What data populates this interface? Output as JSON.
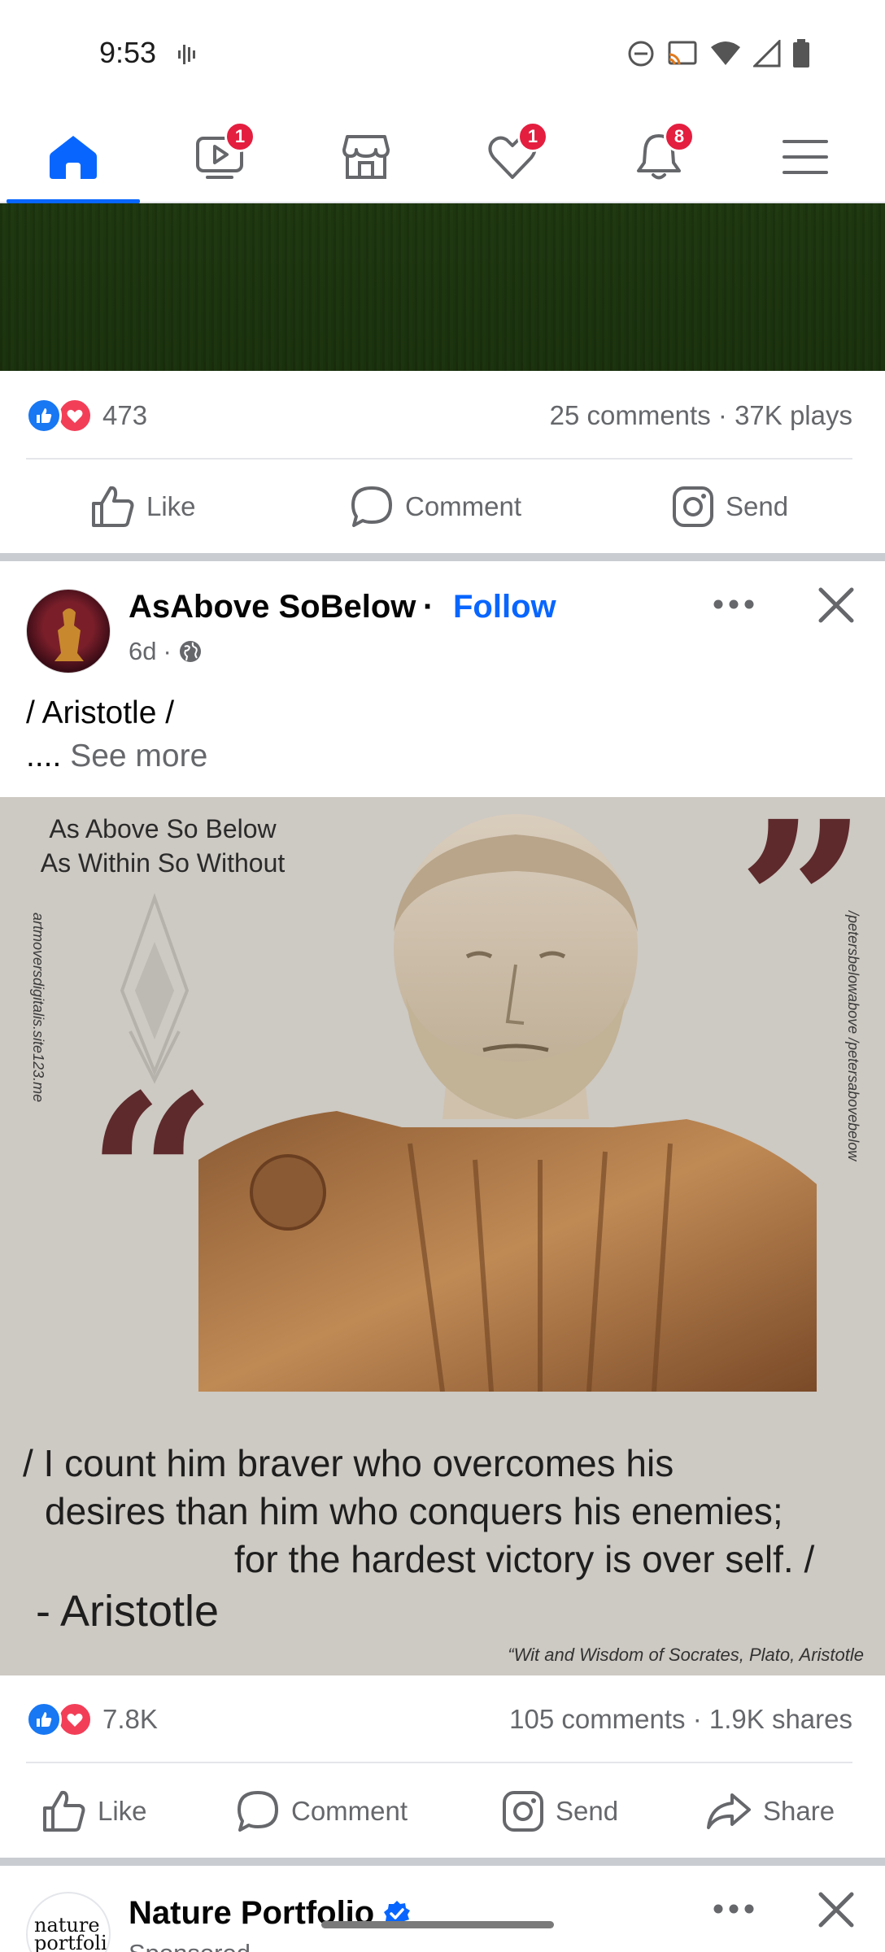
{
  "status_bar": {
    "time": "9:53"
  },
  "nav": {
    "tabs": [
      {
        "name": "home",
        "badge": ""
      },
      {
        "name": "video",
        "badge": "1"
      },
      {
        "name": "marketplace",
        "badge": ""
      },
      {
        "name": "dating",
        "badge": "1"
      },
      {
        "name": "notifications",
        "badge": "8"
      },
      {
        "name": "menu",
        "badge": ""
      }
    ],
    "colors": {
      "active": "#0866ff",
      "badge": "#e41e3f"
    }
  },
  "post1": {
    "reactions_count": "473",
    "comments": "25 comments",
    "plays": "37K plays",
    "actions": {
      "like": "Like",
      "comment": "Comment",
      "send": "Send"
    }
  },
  "post2": {
    "author": "AsAbove SoBelow",
    "follow": "Follow",
    "time": "6d",
    "text": "/ Aristotle /",
    "ellipsis": "....",
    "see_more": "See more",
    "image": {
      "top_line1": "As Above So Below",
      "top_line2": "As Within So Without",
      "left_vertical": "artmoversdigitalis.site123.me",
      "right_vertical": "/petersbelowabove   /petersabovebelow",
      "quote_line1": "/ I count him braver who overcomes his",
      "quote_line2": "desires than him who conquers his enemies;",
      "quote_line3": "for the hardest victory is over self. /",
      "attribution": "- Aristotle",
      "source": "“Wit and Wisdom of Socrates, Plato, Aristotle"
    },
    "reactions_count": "7.8K",
    "comments": "105 comments",
    "shares": "1.9K shares",
    "actions": {
      "like": "Like",
      "comment": "Comment",
      "send": "Send",
      "share": "Share"
    }
  },
  "post3": {
    "author": "Nature Portfolio",
    "avatar_text_1": "nature",
    "avatar_text_2": "portfolio",
    "sub": "Sponsored"
  }
}
